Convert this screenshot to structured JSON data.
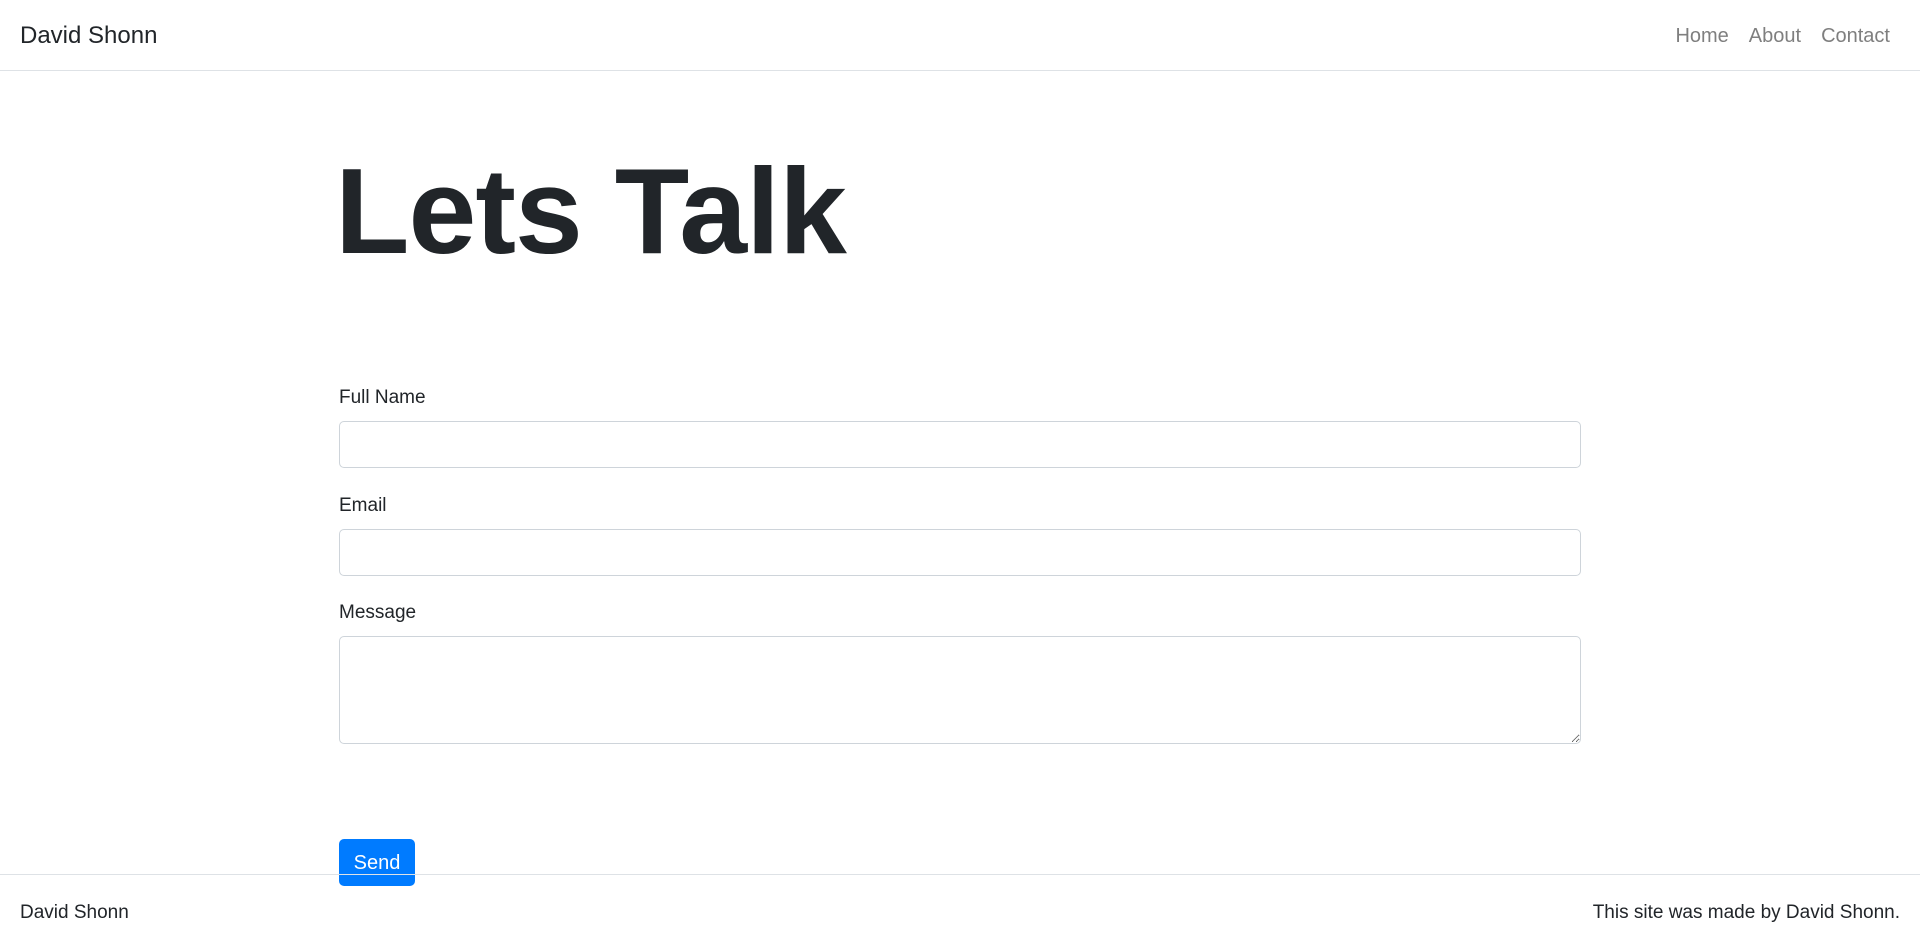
{
  "navbar": {
    "brand": "David Shonn",
    "links": [
      "Home",
      "About",
      "Contact"
    ]
  },
  "main": {
    "heading": "Lets Talk",
    "form": {
      "full_name_label": "Full Name",
      "full_name_value": "",
      "email_label": "Email",
      "email_value": "",
      "message_label": "Message",
      "message_value": "",
      "send_label": "Send"
    }
  },
  "footer": {
    "left_text": "David Shonn",
    "right_text": "This site was made by David Shonn."
  },
  "colors": {
    "accent": "#007bff",
    "text": "#212529",
    "nav_link": "#7f7f7f",
    "border": "#ced4da"
  }
}
